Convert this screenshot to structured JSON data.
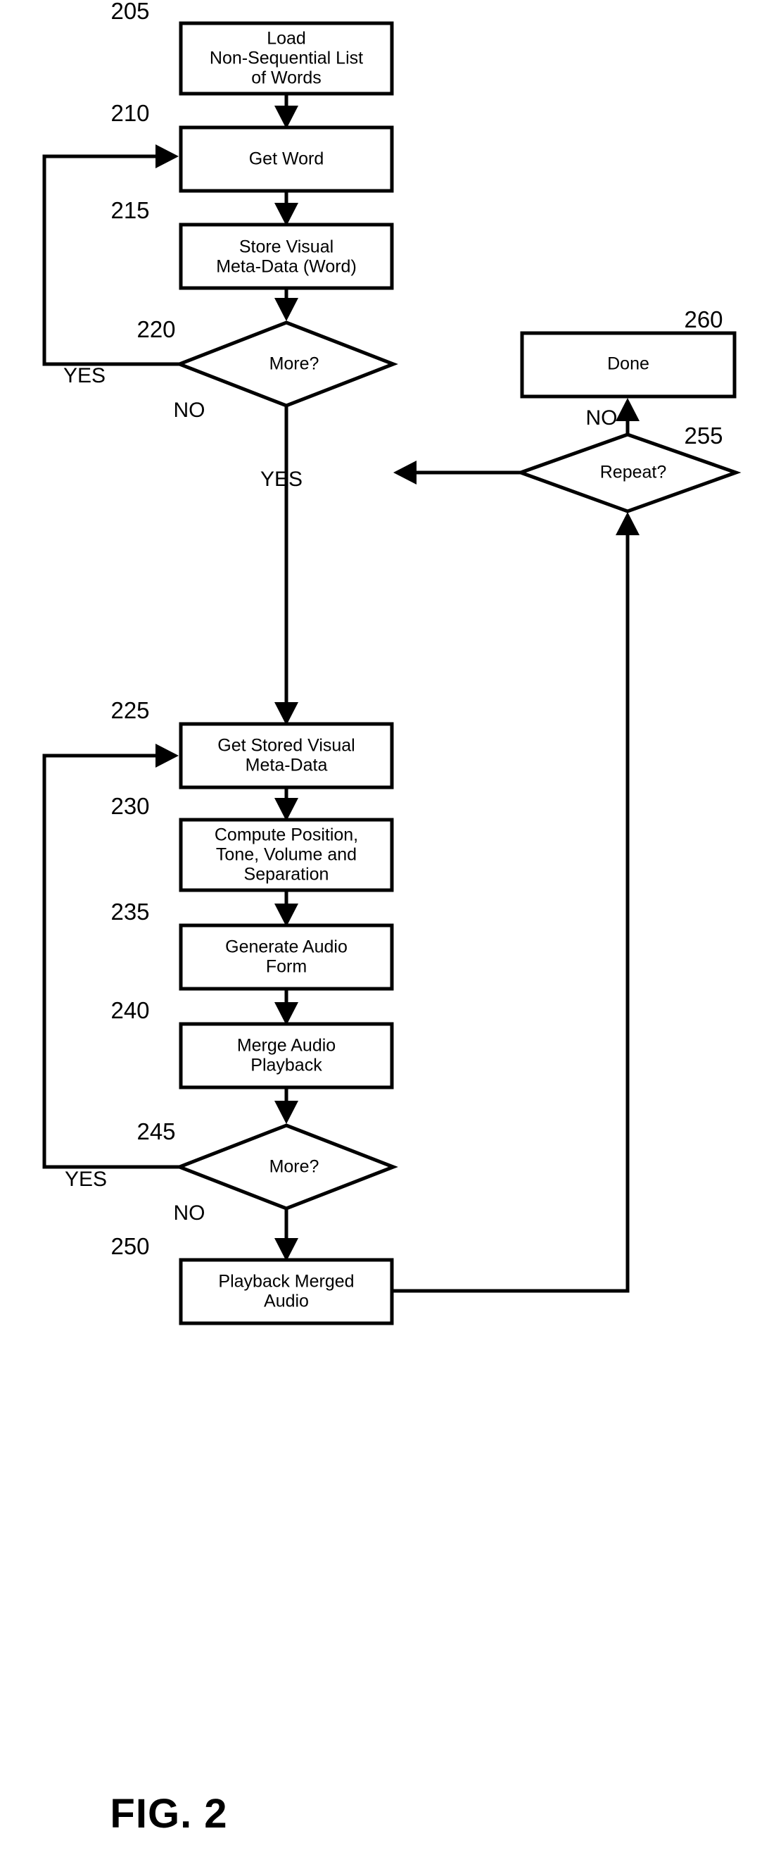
{
  "figure": {
    "caption": "FIG. 2",
    "type": "flowchart",
    "orientation": "vertical-two-column"
  },
  "nodes": [
    {
      "id": "205",
      "ref": "205",
      "shape": "process",
      "lines": [
        "Load",
        "Non-Sequential List",
        "of Words"
      ]
    },
    {
      "id": "210",
      "ref": "210",
      "shape": "process",
      "lines": [
        "Get Word"
      ]
    },
    {
      "id": "215",
      "ref": "215",
      "shape": "process",
      "lines": [
        "Store Visual",
        "Meta-Data (Word)"
      ]
    },
    {
      "id": "220",
      "ref": "220",
      "shape": "decision",
      "lines": [
        "More?"
      ]
    },
    {
      "id": "225",
      "ref": "225",
      "shape": "process",
      "lines": [
        "Get Stored Visual",
        "Meta-Data"
      ]
    },
    {
      "id": "230",
      "ref": "230",
      "shape": "process",
      "lines": [
        "Compute Position,",
        "Tone, Volume and",
        "Separation"
      ]
    },
    {
      "id": "235",
      "ref": "235",
      "shape": "process",
      "lines": [
        "Generate Audio",
        "Form"
      ]
    },
    {
      "id": "240",
      "ref": "240",
      "shape": "process",
      "lines": [
        "Merge Audio",
        "Playback"
      ]
    },
    {
      "id": "245",
      "ref": "245",
      "shape": "decision",
      "lines": [
        "More?"
      ]
    },
    {
      "id": "250",
      "ref": "250",
      "shape": "process",
      "lines": [
        "Playback Merged",
        "Audio"
      ]
    },
    {
      "id": "255",
      "ref": "255",
      "shape": "decision",
      "lines": [
        "Repeat?"
      ]
    },
    {
      "id": "260",
      "ref": "260",
      "shape": "process",
      "lines": [
        "Done"
      ]
    }
  ],
  "edges": [
    {
      "from": "205",
      "to": "210",
      "label": ""
    },
    {
      "from": "210",
      "to": "215",
      "label": ""
    },
    {
      "from": "215",
      "to": "220",
      "label": ""
    },
    {
      "from": "220",
      "to": "210",
      "label": "YES"
    },
    {
      "from": "220",
      "to": "225",
      "label": "NO"
    },
    {
      "from": "225",
      "to": "230",
      "label": ""
    },
    {
      "from": "230",
      "to": "235",
      "label": ""
    },
    {
      "from": "235",
      "to": "240",
      "label": ""
    },
    {
      "from": "240",
      "to": "245",
      "label": ""
    },
    {
      "from": "245",
      "to": "225",
      "label": "YES"
    },
    {
      "from": "245",
      "to": "250",
      "label": "NO"
    },
    {
      "from": "250",
      "to": "255",
      "label": ""
    },
    {
      "from": "255",
      "to": "225",
      "label": "YES"
    },
    {
      "from": "255",
      "to": "260",
      "label": "NO"
    }
  ],
  "edge_labels": {
    "yes_220": "YES",
    "no_220": "NO",
    "yes_245": "YES",
    "no_245": "NO",
    "yes_255": "YES",
    "no_255": "NO"
  },
  "node_text": {
    "n205_l1": "Load",
    "n205_l2": "Non-Sequential List",
    "n205_l3": "of Words",
    "n210_l1": "Get Word",
    "n215_l1": "Store Visual",
    "n215_l2": "Meta-Data (Word)",
    "n220_l1": "More?",
    "n225_l1": "Get Stored Visual",
    "n225_l2": "Meta-Data",
    "n230_l1": "Compute Position,",
    "n230_l2": "Tone, Volume and",
    "n230_l3": "Separation",
    "n235_l1": "Generate Audio",
    "n235_l2": "Form",
    "n240_l1": "Merge Audio",
    "n240_l2": "Playback",
    "n245_l1": "More?",
    "n250_l1": "Playback Merged",
    "n250_l2": "Audio",
    "n255_l1": "Repeat?",
    "n260_l1": "Done"
  },
  "ref_numbers": {
    "r205": "205",
    "r210": "210",
    "r215": "215",
    "r220": "220",
    "r225": "225",
    "r230": "230",
    "r235": "235",
    "r240": "240",
    "r245": "245",
    "r250": "250",
    "r255": "255",
    "r260": "260"
  },
  "colors": {
    "stroke": "#000000",
    "fill": "#ffffff",
    "background": "#ffffff"
  }
}
